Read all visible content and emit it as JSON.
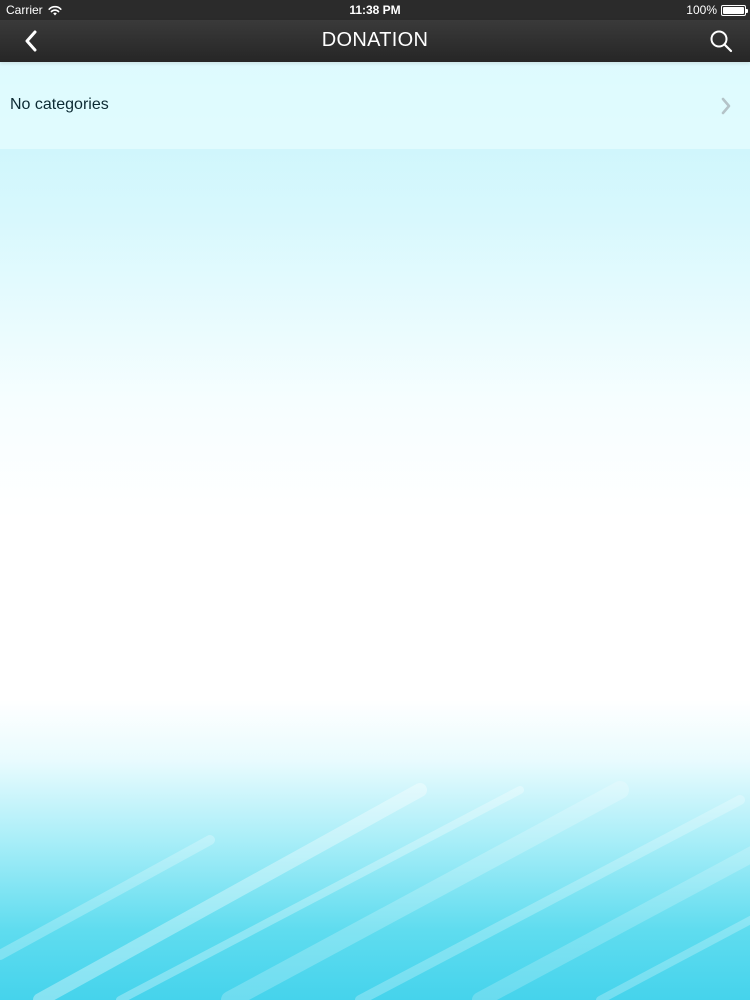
{
  "status_bar": {
    "carrier": "Carrier",
    "time": "11:38 PM",
    "battery": "100%",
    "battery_level": 1.0
  },
  "nav_bar": {
    "title": "DONATION",
    "back_icon": "chevron-left-icon",
    "search_icon": "search-icon"
  },
  "categories": {
    "empty_label": "No categories",
    "row_icon": "chevron-right-icon"
  },
  "colors": {
    "bar_dark": "#2b2b2b",
    "row_background": "#e6fcff",
    "gradient_cyan": "#45d3ec",
    "chevron_gray": "#b4c3c8"
  }
}
